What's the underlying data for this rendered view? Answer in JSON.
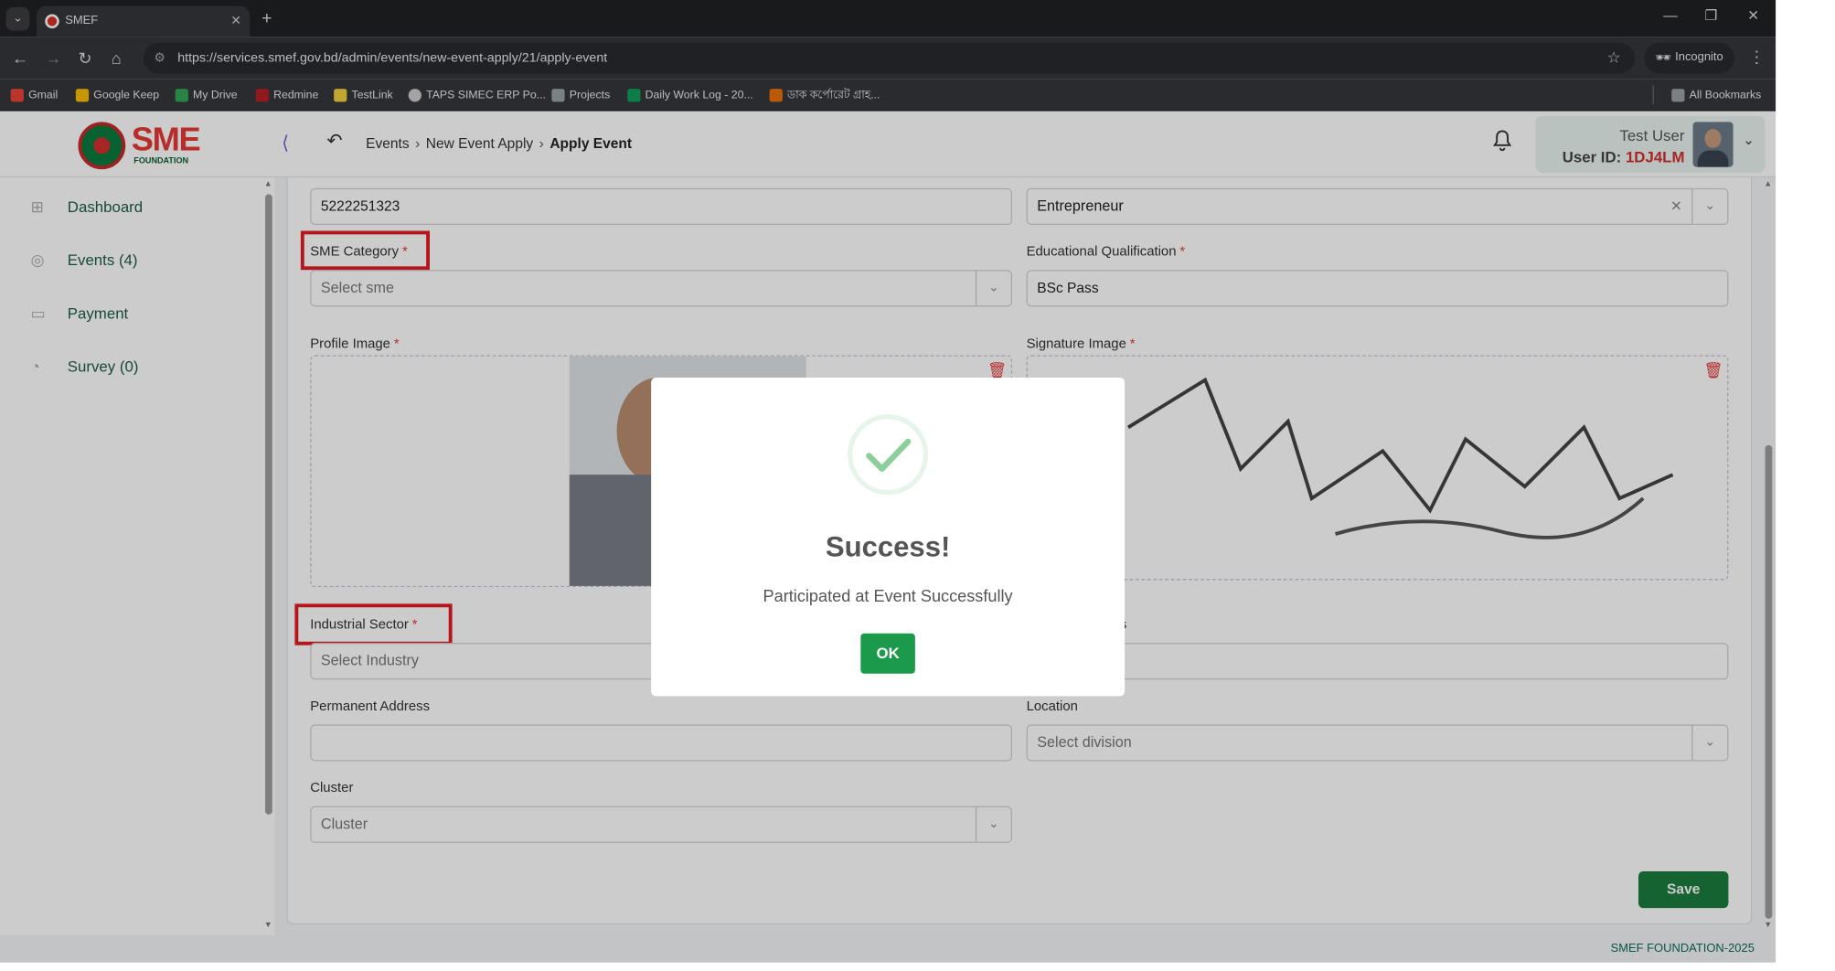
{
  "browser": {
    "tab_title": "SMEF",
    "url": "https://services.smef.gov.bd/admin/events/new-event-apply/21/apply-event",
    "incognito_label": "Incognito",
    "bookmarks": [
      {
        "label": "Gmail",
        "color": "#ea4335"
      },
      {
        "label": "Google Keep",
        "color": "#fbbc04"
      },
      {
        "label": "My Drive",
        "color": "#34a853"
      },
      {
        "label": "Redmine",
        "color": "#b32024"
      },
      {
        "label": "TestLink",
        "color": "#f4d03f"
      },
      {
        "label": "TAPS SIMEC ERP Po...",
        "color": "#cccccc"
      },
      {
        "label": "Projects",
        "color": "#9aa0a6"
      },
      {
        "label": "Daily Work Log - 20...",
        "color": "#0f9d58"
      },
      {
        "label": "ডাক কর্পোরেট গ্রাহ...",
        "color": "#e8710a"
      }
    ],
    "all_bookmarks": "All Bookmarks"
  },
  "header": {
    "logo_text": "SME",
    "logo_subtext": "FOUNDATION",
    "breadcrumb": [
      "Events",
      "New Event Apply",
      "Apply Event"
    ],
    "user_name": "Test User",
    "user_id_label": "User ID:",
    "user_id": "1DJ4LM"
  },
  "sidebar": {
    "items": [
      {
        "label": "Dashboard",
        "icon": "grid-icon"
      },
      {
        "label": "Events (4)",
        "icon": "events-icon"
      },
      {
        "label": "Payment",
        "icon": "payment-icon"
      },
      {
        "label": "Survey (0)",
        "icon": "survey-icon"
      }
    ]
  },
  "form": {
    "phone_value": "5222251323",
    "occupation_value": "Entrepreneur",
    "sme_category_label": "SME Category",
    "sme_category_placeholder": "Select sme",
    "education_label": "Educational Qualification",
    "education_value": "BSc Pass",
    "profile_image_label": "Profile Image",
    "signature_image_label": "Signature Image",
    "industrial_sector_label": "Industrial Sector",
    "industrial_sector_placeholder": "Select Industry",
    "partial_label": "s",
    "permanent_address_label": "Permanent Address",
    "permanent_address_value": "",
    "location_label": "Location",
    "location_placeholder": "Select division",
    "cluster_label": "Cluster",
    "cluster_placeholder": "Cluster",
    "save_label": "Save"
  },
  "modal": {
    "title": "Success!",
    "message": "Participated at Event Successfully",
    "ok_label": "OK"
  },
  "footer": {
    "text": "SMEF FOUNDATION-2025"
  },
  "colors": {
    "accent": "#1b7c3e",
    "highlight": "#e21c22",
    "user_id": "#d32f2f"
  }
}
